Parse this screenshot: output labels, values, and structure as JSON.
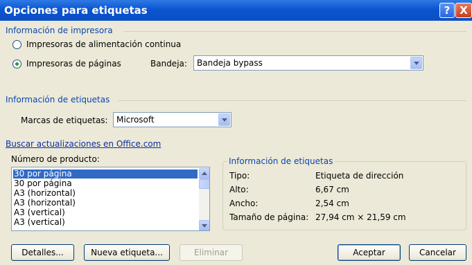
{
  "window": {
    "title": "Opciones para etiquetas",
    "help_glyph": "?",
    "close_glyph": "X"
  },
  "printer_info": {
    "section": "Información de impresora",
    "radio_continuous": "Impresoras de alimentación continua",
    "radio_pages": "Impresoras de páginas",
    "selected": "pages",
    "tray_label": "Bandeja:",
    "tray_value": "Bandeja bypass"
  },
  "label_info": {
    "section": "Información de etiquetas",
    "brand_label": "Marcas de etiquetas:",
    "brand_value": "Microsoft"
  },
  "updates_link": "Buscar actualizaciones en Office.com",
  "product": {
    "label": "Número de producto:",
    "items": [
      "30 por página",
      "30 por página",
      "A3 (horizontal)",
      "A3 (horizontal)",
      "A3 (vertical)",
      "A3 (vertical)"
    ],
    "selected_index": 0
  },
  "details_group": {
    "title": "Información de etiquetas",
    "rows": [
      {
        "key": "Tipo:",
        "value": "Etiqueta de dirección"
      },
      {
        "key": "Alto:",
        "value": "6,67 cm"
      },
      {
        "key": "Ancho:",
        "value": "2,54 cm"
      },
      {
        "key": "Tamaño de página:",
        "value": "27,94 cm × 21,59 cm"
      }
    ]
  },
  "buttons": {
    "details": "Detalles...",
    "new_label": "Nueva etiqueta...",
    "delete": "Eliminar",
    "ok": "Aceptar",
    "cancel": "Cancelar"
  },
  "colors": {
    "title_bar": "#0a55d1",
    "section_text": "#0a46b0",
    "selection": "#316ac5",
    "dialog_bg": "#ece9d8"
  }
}
